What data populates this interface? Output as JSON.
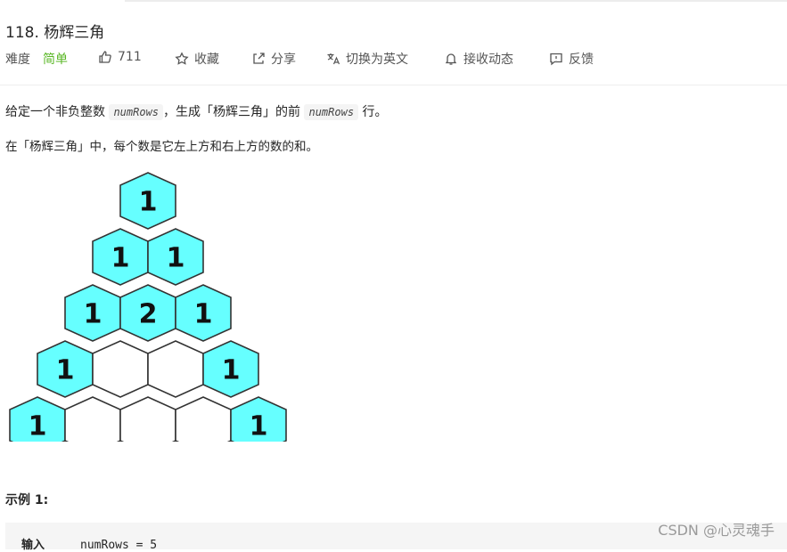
{
  "problem": {
    "title": "118. 杨辉三角",
    "difficulty_label": "难度",
    "difficulty_value": "简单",
    "likes": "711",
    "collect_label": "收藏",
    "share_label": "分享",
    "lang_label": "切换为英文",
    "subscribe_label": "接收动态",
    "feedback_label": "反馈"
  },
  "description": {
    "p1_a": "给定一个非负整数 ",
    "p1_code1": "numRows",
    "p1_b": "，生成「杨辉三角」的前 ",
    "p1_code2": "numRows",
    "p1_c": " 行。",
    "p2": "在「杨辉三角」中，每个数是它左上方和右上方的数的和。"
  },
  "triangle": {
    "rows": [
      [
        "1"
      ],
      [
        "1",
        "1"
      ],
      [
        "1",
        "2",
        "1"
      ],
      [
        "1",
        "",
        "",
        "1"
      ],
      [
        "1",
        "",
        "",
        "",
        "1"
      ]
    ],
    "fill_color": "#66ffff",
    "empty_color": "#ffffff"
  },
  "example": {
    "title": "示例 1:",
    "input_label": "输入",
    "input_value": "numRows = 5"
  },
  "watermark": "CSDN @心灵魂手"
}
